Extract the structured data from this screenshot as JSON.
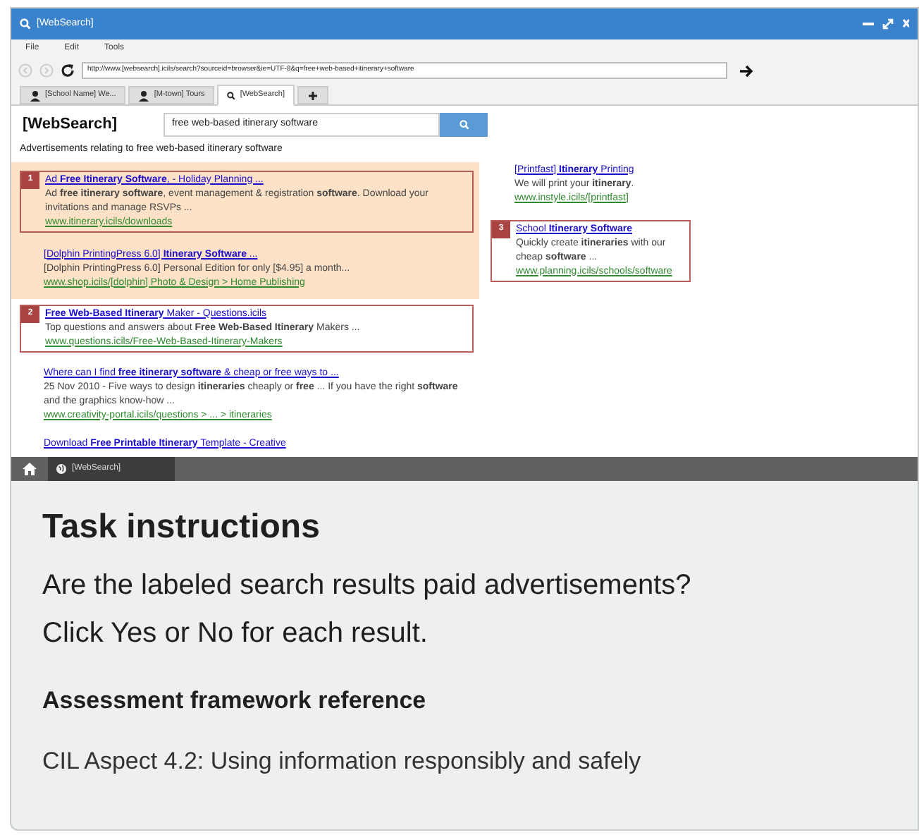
{
  "window": {
    "title": "[WebSearch]"
  },
  "menu": [
    "File",
    "Edit",
    "Tools"
  ],
  "address_bar": {
    "url": "http://www.[websearch].icils/search?sourceid=browser&ie=UTF-8&q=free+web-based+itinerary+software"
  },
  "tabs": [
    {
      "label": "[School Name] We...",
      "kind": "person",
      "selected": false
    },
    {
      "label": "[M-town] Tours",
      "kind": "person",
      "selected": false
    },
    {
      "label": "[WebSearch]",
      "kind": "search",
      "selected": true
    }
  ],
  "page": {
    "logo": "[WebSearch]",
    "search": {
      "value": "free web-based itinerary software"
    },
    "ads_heading": "Advertisements relating to free web-based itinerary software",
    "ads": [
      {
        "number": "1",
        "title": "Ad **Free Itinerary Software**, - Holiday Planning ...",
        "description": "Ad **free itinerary software**, event management & registration **software**. Download your invitations and manage RSVPs ...",
        "url": "www.itinerary.icils/downloads"
      },
      {
        "title": "[Dolphin PrintingPress 6.0] **Itinerary Software** ...",
        "description": "[Dolphin PrintingPress 6.0] Personal Edition for only [$4.95] a month...",
        "url": "www.shop.icils/[dolphin] Photo & Design > Home Publishing"
      }
    ],
    "results": [
      {
        "number": "2",
        "title": "**Free Web-Based Itinerary** Maker - Questions.icils",
        "description": "Top questions and answers about **Free Web-Based Itinerary** Makers ...",
        "url": "www.questions.icils/Free-Web-Based-Itinerary-Makers"
      },
      {
        "title": "Where can I find **free itinerary software** & cheap or free ways to ...",
        "description": "25 Nov 2010 - Five ways to design **itineraries** cheaply or **free** ... If you have the right **software** and the graphics know-how ...",
        "url": "www.creativity-portal.icils/questions > ... > itineraries"
      },
      {
        "title": "Download **Free Printable Itinerary** Template - Creative"
      }
    ],
    "side_ads": [
      {
        "title": "[Printfast] **Itinerary** Printing",
        "description": "We will print your **itinerary**.",
        "url": "www.instyle.icils/[printfast]"
      },
      {
        "number": "3",
        "title": "School **Itinerary Software**",
        "description": "Quickly create **itineraries** with our cheap **software** ...",
        "url": "www.planning.icils/schools/software"
      }
    ]
  },
  "taskbar": {
    "items": [
      {
        "label": "[WebSearch]"
      }
    ]
  },
  "task": {
    "heading": "Task instructions",
    "text": [
      "Are the labeled search results paid advertisements?",
      "Click Yes or No for each result."
    ],
    "reference_heading": "Assessment framework reference",
    "reference": "CIL Aspect 4.2: Using information responsibly and safely"
  }
}
